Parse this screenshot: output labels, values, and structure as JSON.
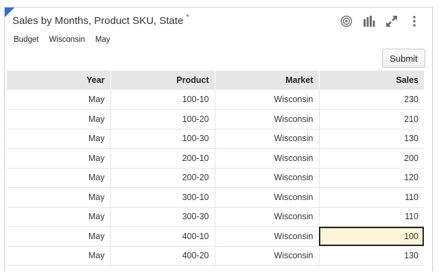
{
  "header": {
    "title": "Sales by Months, Product SKU, State",
    "modified_marker": "*"
  },
  "toolbar": {
    "icons": [
      "target-icon",
      "bar-chart-icon",
      "expand-icon",
      "more-vertical-icon"
    ]
  },
  "pov": {
    "scenario": "Budget",
    "market": "Wisconsin",
    "period": "May"
  },
  "actions": {
    "submit_label": "Submit"
  },
  "grid": {
    "columns": [
      "Year",
      "Product",
      "Market",
      "Sales"
    ],
    "rows": [
      [
        "May",
        "100-10",
        "Wisconsin",
        "230"
      ],
      [
        "May",
        "100-20",
        "Wisconsin",
        "210"
      ],
      [
        "May",
        "100-30",
        "Wisconsin",
        "130"
      ],
      [
        "May",
        "200-10",
        "Wisconsin",
        "200"
      ],
      [
        "May",
        "200-20",
        "Wisconsin",
        "120"
      ],
      [
        "May",
        "300-10",
        "Wisconsin",
        "110"
      ],
      [
        "May",
        "300-30",
        "Wisconsin",
        "110"
      ],
      [
        "May",
        "400-10",
        "Wisconsin",
        "100"
      ],
      [
        "May",
        "400-20",
        "Wisconsin",
        "130"
      ]
    ],
    "selected_cell": {
      "row": 7,
      "col": 3
    }
  },
  "colors": {
    "accent": "#2f6ed8",
    "header_bg": "#e6e6e6",
    "selected_bg": "#fdf3d7"
  }
}
